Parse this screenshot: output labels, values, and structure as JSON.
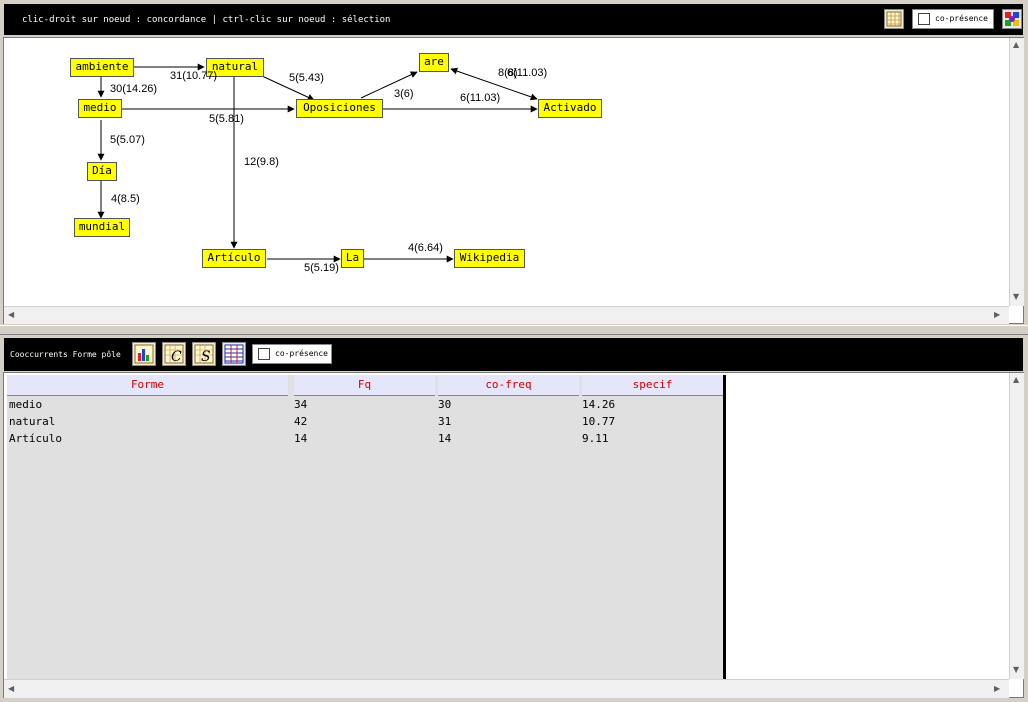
{
  "top_toolbar": {
    "hint": "clic-droit sur noeud : concordance | ctrl-clic sur noeud : sélection",
    "copresence_label": "co-présence",
    "copresence_checked": false,
    "icons": [
      "grid-icon",
      "palette-icon"
    ]
  },
  "graph": {
    "nodes": {
      "ambiente": "ambiente",
      "natural": "natural",
      "medio": "medio",
      "oposiciones": "Oposiciones",
      "are": "are",
      "activado": "Activado",
      "dia": "Día",
      "mundial": "mundial",
      "articulo": "Artículo",
      "la": "La",
      "wikipedia": "Wikipedia"
    },
    "edges": {
      "ambiente_natural": "31(10.77)",
      "ambiente_medio": "30(14.26)",
      "natural_oposiciones": "5(5.43)",
      "medio_oposiciones": "5(5.81)",
      "oposiciones_are": "3(6)",
      "are_activado_a": "8(8)",
      "are_activado_b": "6(11.03)",
      "oposiciones_activado": "6(11.03)",
      "medio_dia": "5(5.07)",
      "natural_articulo": "12(9.8)",
      "dia_mundial": "4(8.5)",
      "articulo_la": "5(5.19)",
      "la_wikipedia": "4(6.64)"
    }
  },
  "bottom_toolbar": {
    "title": "Cooccurrents Forme pôle",
    "copresence_label": "co-présence",
    "copresence_checked": false,
    "icons": [
      "chart-icon",
      "c-icon",
      "s-icon",
      "table-icon"
    ]
  },
  "table": {
    "headers": [
      "Forme",
      "Fq",
      "co-freq",
      "specif"
    ],
    "rows": [
      [
        "medio",
        "34",
        "30",
        "14.26"
      ],
      [
        "natural",
        "42",
        "31",
        "10.77"
      ],
      [
        "Artículo",
        "14",
        "14",
        "9.11"
      ]
    ]
  },
  "colors": {
    "node_fill": "#ffff00",
    "header_text": "#cc0000",
    "header_bg": "#e6e6fa",
    "toolbar_bg": "#000000"
  }
}
